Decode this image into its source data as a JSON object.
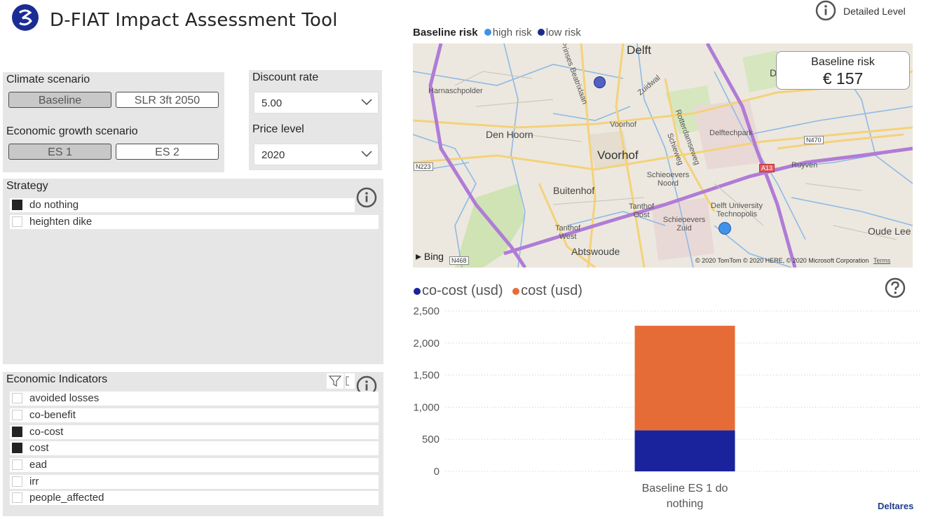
{
  "header": {
    "title": "D-FIAT Impact Assessment Tool",
    "detail_level_label": "Detailed Level"
  },
  "climate": {
    "label": "Climate scenario",
    "options": [
      "Baseline",
      "SLR 3ft 2050"
    ],
    "selected": "Baseline"
  },
  "economic_growth": {
    "label": "Economic growth scenario",
    "options": [
      "ES 1",
      "ES 2"
    ],
    "selected": "ES 1"
  },
  "discount_rate": {
    "label": "Discount rate",
    "value": "5.00"
  },
  "price_level": {
    "label": "Price level",
    "value": "2020"
  },
  "strategy": {
    "label": "Strategy",
    "items": [
      {
        "label": "do nothing",
        "checked": true
      },
      {
        "label": "heighten dike",
        "checked": false
      }
    ]
  },
  "indicators": {
    "label": "Economic Indicators",
    "items": [
      {
        "label": "avoided losses",
        "checked": false
      },
      {
        "label": "co-benefit",
        "checked": false
      },
      {
        "label": "co-cost",
        "checked": true
      },
      {
        "label": "cost",
        "checked": true
      },
      {
        "label": "ead",
        "checked": false
      },
      {
        "label": "irr",
        "checked": false
      },
      {
        "label": "people_affected",
        "checked": false
      }
    ]
  },
  "map": {
    "title": "Baseline risk",
    "legend": [
      {
        "label": "high risk",
        "color": "#3f92e8"
      },
      {
        "label": "low risk",
        "color": "#1c2a8c"
      }
    ],
    "card_label": "Baseline risk",
    "card_value": "€ 157",
    "places": {
      "delft": "Delft",
      "harnaschpolder": "Harnaschpolder",
      "prinses": "Prinses Beatrixlaan",
      "zuidwal": "Zuidwal",
      "den_hoorn": "Den Hoorn",
      "voorhof_small": "Voorhof",
      "voorhof": "Voorhof",
      "rotterdamseweg": "Rotterdamseweg",
      "schieweg": "Schieweg",
      "delftechpark": "Delftechpark",
      "buitenhof": "Buitenhof",
      "schieoevers_noord": "Schieoevers Noord",
      "tanthof_oost": "Tanthof Oost",
      "schieoevers_zuid": "Schieoevers Zuid",
      "delft_university": "Delft University Technopolis",
      "ruyven": "Ruyven",
      "tanthof_west": "Tanthof West",
      "abtswoude": "Abtswoude",
      "oude_leede": "Oude Lee",
      "d_edge": "D",
      "n223": "N223",
      "n470": "N470",
      "a13": "A13",
      "n468": "N468"
    },
    "bing_label": "Bing",
    "attribution": "© 2020 TomTom © 2020 HERE, © 2020 Microsoft Corporation",
    "terms": "Terms"
  },
  "chart_data": {
    "type": "bar",
    "stacked": true,
    "categories": [
      "Baseline ES 1 do nothing"
    ],
    "series": [
      {
        "name": "co-cost (usd)",
        "values": [
          640
        ],
        "color": "#1a239c"
      },
      {
        "name": "cost (usd)",
        "values": [
          1630
        ],
        "color": "#e66c37"
      }
    ],
    "ylim": [
      0,
      2500
    ],
    "yticks": [
      "0",
      "500",
      "1,000",
      "1,500",
      "2,000",
      "2,500"
    ],
    "ytick_values": [
      0,
      500,
      1000,
      1500,
      2000,
      2500
    ],
    "category_label_lines": [
      "Baseline ES 1 do",
      "nothing"
    ],
    "grid": true,
    "legend_position": "top-left"
  },
  "footer": {
    "brand": "Deltares"
  }
}
